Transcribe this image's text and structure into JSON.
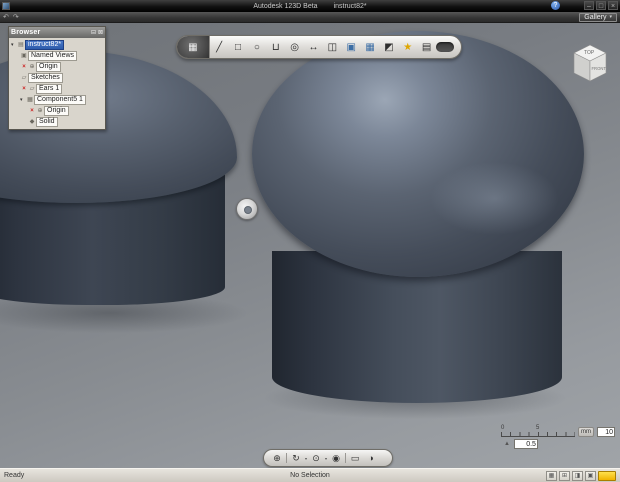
{
  "window": {
    "app_title": "Autodesk 123D Beta",
    "doc_title": "instruct82*"
  },
  "icons": {
    "help": "?",
    "minimize": "–",
    "maximize": "□",
    "close": "×",
    "undo": "↶",
    "redo": "↷",
    "gallery_chevron": "▾",
    "browser_collapse": "⊟",
    "browser_close": "⊠",
    "tree_expanded": "▾",
    "red_x": "×",
    "document": "▤",
    "named_views": "▣",
    "origin": "⊕",
    "sketch": "▱",
    "component": "▦",
    "solid": "◆",
    "menu_cube": "▦",
    "slider_marker": "▲",
    "status_grid": "▦",
    "status_snap": "⊞",
    "status_ortho": "◨",
    "status_filter": "▣"
  },
  "menubar": {
    "gallery_label": "Gallery"
  },
  "browser": {
    "title": "Browser",
    "tree": [
      {
        "label": "instruct82*"
      },
      {
        "label": "Named Views"
      },
      {
        "label": "Origin"
      },
      {
        "label": "Sketches"
      },
      {
        "label": "Ears 1"
      },
      {
        "label": "Component5 1"
      },
      {
        "label": "Origin"
      },
      {
        "label": "Solid"
      }
    ]
  },
  "toolbar": {
    "tools": [
      {
        "name": "sketch",
        "glyph": "╱"
      },
      {
        "name": "box",
        "glyph": "□"
      },
      {
        "name": "sphere",
        "glyph": "○"
      },
      {
        "name": "cylinder",
        "glyph": "⊔"
      },
      {
        "name": "torus",
        "glyph": "◎"
      },
      {
        "name": "move",
        "glyph": "↔"
      },
      {
        "name": "split",
        "glyph": "◫"
      },
      {
        "name": "combine",
        "glyph": "▣"
      },
      {
        "name": "pattern",
        "glyph": "▦"
      },
      {
        "name": "material",
        "glyph": "◩"
      },
      {
        "name": "gallery",
        "glyph": "★"
      },
      {
        "name": "grid",
        "glyph": "▤"
      }
    ]
  },
  "viewcube": {
    "top": "TOP",
    "front": "FRONT"
  },
  "navbar": {
    "tools": [
      {
        "name": "pan",
        "glyph": "⊕"
      },
      {
        "name": "orbit",
        "glyph": "↻"
      },
      {
        "name": "zoom",
        "glyph": "⊙"
      },
      {
        "name": "look-at",
        "glyph": "◉"
      },
      {
        "name": "fit",
        "glyph": "▭"
      },
      {
        "name": "display",
        "glyph": "◑"
      }
    ]
  },
  "scale_widget": {
    "tick_start": "0",
    "tick_mid": "5",
    "unit": "mm",
    "grid_value": "10",
    "snap_value": "0.5"
  },
  "statusbar": {
    "left": "Ready",
    "center": "No Selection"
  },
  "colors": {
    "selection_blue": "#2d5bab",
    "badge_yellow": "#f0b400",
    "red_x": "#cc2222",
    "star_yellow": "#dfa600",
    "dome_base": "#49525f",
    "viewport_top": "#6f7378",
    "viewport_bottom": "#a0a4a8"
  }
}
